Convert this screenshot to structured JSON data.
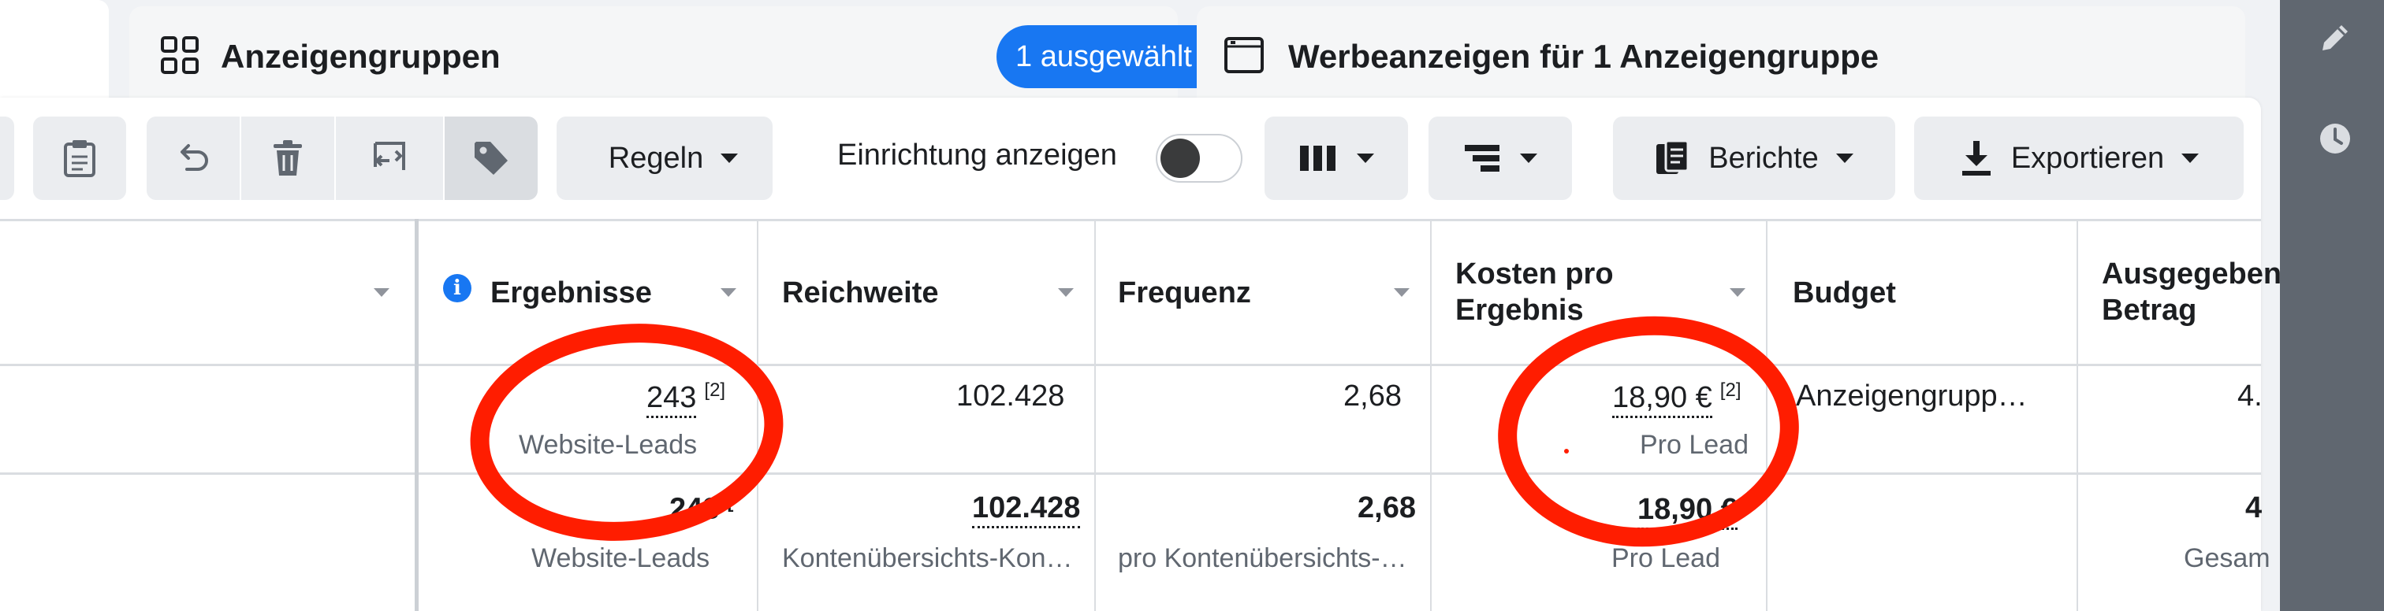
{
  "tabs": {
    "groups": {
      "title": "Anzeigengruppen",
      "selected_badge": "1 ausgewählt"
    },
    "ads": {
      "title": "Werbeanzeigen für 1 Anzeigengruppe"
    }
  },
  "toolbar": {
    "rules_label": "Regeln",
    "setup_toggle_label": "Einrichtung anzeigen",
    "setup_toggle_on": false,
    "reports_label": "Berichte",
    "export_label": "Exportieren",
    "icons": [
      "clipboard-icon",
      "undo-icon",
      "trash-icon",
      "duplicate-icon",
      "tag-icon",
      "columns-icon",
      "breakdown-icon",
      "reports-icon",
      "download-icon"
    ]
  },
  "table": {
    "headers": {
      "results": "Ergebnisse",
      "reach": "Reichweite",
      "frequency": "Frequenz",
      "cost_per_result_line1": "Kosten pro",
      "cost_per_result_line2": "Ergebnis",
      "budget": "Budget",
      "spent_line1": "Ausgegeben",
      "spent_line2": "Betrag"
    },
    "row": {
      "results": "243",
      "results_ref": "[2]",
      "results_sub": "Website-Leads",
      "reach": "102.428",
      "frequency": "2,68",
      "cost_per_result": "18,90 €",
      "cost_per_result_ref": "[2]",
      "cost_per_result_sub": "Pro Lead",
      "budget": "Anzeigengrupp…",
      "spent": "4."
    },
    "summary": {
      "results": "243",
      "results_ref": "[",
      "results_sub": "Website-Leads",
      "reach": "102.428",
      "reach_sub": "Kontenübersichts-Kon…",
      "frequency": "2,68",
      "frequency_sub": "pro Kontenübersichts-…",
      "cost_per_result": "18,90 €",
      "cost_per_result_ref": "[",
      "cost_per_result_sub": "Pro Lead",
      "spent": "4",
      "spent_sub": "Gesam"
    }
  },
  "colors": {
    "accent": "#1877f2",
    "annotation": "#ff1d00",
    "rail": "#606770"
  }
}
